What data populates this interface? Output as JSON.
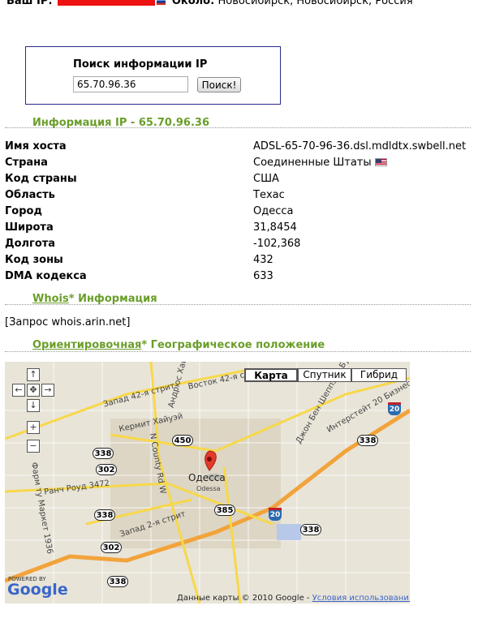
{
  "topbar": {
    "ip_label": "Ваш IP:",
    "near_label": "Около:",
    "location": "Новосибирск, Новосибирск, Россия"
  },
  "search": {
    "title": "Поиск информации IP",
    "value": "65.70.96.36",
    "button": "Поиск!"
  },
  "info": {
    "heading": "Информация IP - 65.70.96.36",
    "rows": [
      {
        "key": "Имя хоста",
        "value": "ADSL-65-70-96-36.dsl.mdldtx.swbell.net"
      },
      {
        "key": "Страна",
        "value": "Соединенные Штаты"
      },
      {
        "key": "Код страны",
        "value": "США"
      },
      {
        "key": "Область",
        "value": "Техас"
      },
      {
        "key": "Город",
        "value": "Одесса"
      },
      {
        "key": "Широта",
        "value": "31,8454"
      },
      {
        "key": "Долгота",
        "value": "-102,368"
      },
      {
        "key": "Код зоны",
        "value": "432"
      },
      {
        "key": "DMA кодекса",
        "value": "633"
      }
    ]
  },
  "whois": {
    "link": "Whois",
    "asterisk": "*",
    "rest": " Информация",
    "query": "[Запрос whois.arin.net]"
  },
  "geo": {
    "link": "Ориентировочная",
    "asterisk": "*",
    "rest": " Географическое положение"
  },
  "map": {
    "types": [
      "Карта",
      "Спутник",
      "Гибрид"
    ],
    "selected_type": "Карта",
    "city_label": "Одесса",
    "city_label_en": "Odessa",
    "roads": [
      "Восток 42-я стрит",
      "Запад 42-я стрит",
      "Кермит Хайуэй",
      "Андрюс Хайуэй",
      "N County Rd W",
      "Ранч Роуд 3472",
      "Фарм ту Маркет 1936",
      "Запад 2-я стрит",
      "Интерстейт 20 Бизнес",
      "Джон Бен Шеппэрд Бул"
    ],
    "shields": [
      "338",
      "450",
      "302",
      "338",
      "302",
      "338",
      "385",
      "338",
      "338"
    ],
    "interstate": [
      "20",
      "20"
    ],
    "powered_by": "POWERED BY",
    "google": "Google",
    "copyright": "Данные карты © 2010 Google - ",
    "terms": "Условия использования"
  }
}
